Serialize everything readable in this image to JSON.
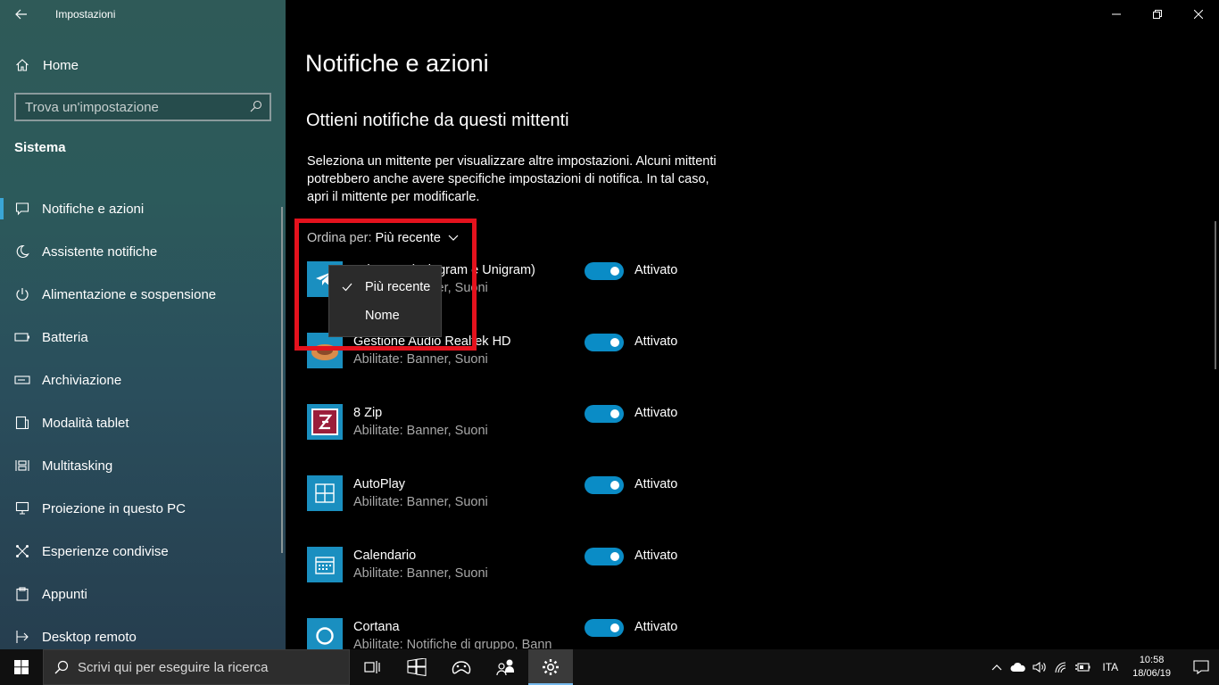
{
  "window": {
    "title": "Impostazioni",
    "minimize_label": "—",
    "maximize_label": "❐",
    "close_label": "✕"
  },
  "sidebar": {
    "home_label": "Home",
    "search_placeholder": "Trova un'impostazione",
    "section_title": "Sistema",
    "items": [
      {
        "label": "Notifiche e azioni",
        "icon": "notification-icon",
        "active": true
      },
      {
        "label": "Assistente notifiche",
        "icon": "moon-icon"
      },
      {
        "label": "Alimentazione e sospensione",
        "icon": "power-icon"
      },
      {
        "label": "Batteria",
        "icon": "battery-icon"
      },
      {
        "label": "Archiviazione",
        "icon": "storage-icon"
      },
      {
        "label": "Modalità tablet",
        "icon": "tablet-icon"
      },
      {
        "label": "Multitasking",
        "icon": "multitasking-icon"
      },
      {
        "label": "Proiezione in questo PC",
        "icon": "projection-icon"
      },
      {
        "label": "Esperienze condivise",
        "icon": "shared-icon"
      },
      {
        "label": "Appunti",
        "icon": "clipboard-icon"
      },
      {
        "label": "Desktop remoto",
        "icon": "remote-icon"
      }
    ]
  },
  "main": {
    "title": "Notifiche e azioni",
    "subtitle": "Ottieni notifiche da questi mittenti",
    "description": "Seleziona un mittente per visualizzare altre impostazioni. Alcuni mittenti potrebbero anche avere specifiche impostazioni di notifica. In tal caso, apri il mittente per modificarle.",
    "sort_label": "Ordina per:",
    "sort_value": "Più recente",
    "dropdown_options": [
      "Più recente",
      "Nome"
    ],
    "senders": [
      {
        "name": "Telegram (Telegram e Unigram)",
        "status": "Abilitate: Banner, Suoni",
        "toggle": "Attivato",
        "icon": "telegram-icon"
      },
      {
        "name": "Gestione Audio Realtek HD",
        "status": "Abilitate: Banner, Suoni",
        "toggle": "Attivato",
        "icon": "realtek-icon"
      },
      {
        "name": "8 Zip",
        "status": "Abilitate: Banner, Suoni",
        "toggle": "Attivato",
        "icon": "8zip-icon"
      },
      {
        "name": "AutoPlay",
        "status": "Abilitate: Banner, Suoni",
        "toggle": "Attivato",
        "icon": "autoplay-icon"
      },
      {
        "name": "Calendario",
        "status": "Abilitate: Banner, Suoni",
        "toggle": "Attivato",
        "icon": "calendar-icon"
      },
      {
        "name": "Cortana",
        "status": "Abilitate: Notifiche di gruppo, Bann",
        "toggle": "Attivato",
        "icon": "cortana-icon"
      }
    ]
  },
  "taskbar": {
    "search_placeholder": "Scrivi qui per eseguire la ricerca",
    "language": "ITA",
    "time": "10:58",
    "date": "18/06/19"
  },
  "colors": {
    "accent": "#0a8cc6",
    "highlight": "#e4121d",
    "active_indicator": "#3aa6d6"
  }
}
